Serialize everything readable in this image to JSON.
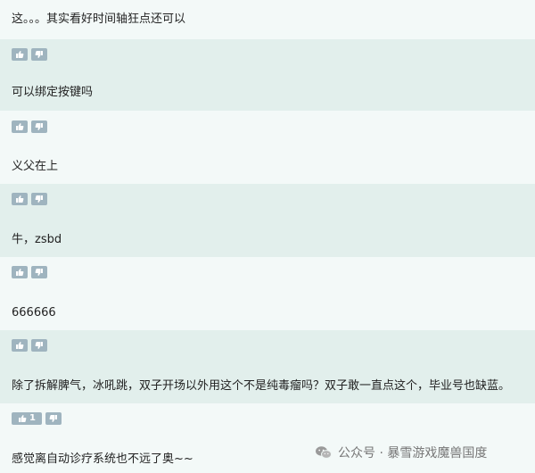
{
  "comments": [
    {
      "text": "这。。。其实看好时间轴狂点还可以",
      "upvotes": ""
    },
    {
      "text": "可以绑定按键吗",
      "upvotes": ""
    },
    {
      "text": "义父在上",
      "upvotes": ""
    },
    {
      "text": "牛，zsbd",
      "upvotes": ""
    },
    {
      "text": "666666",
      "upvotes": ""
    },
    {
      "text": "除了拆解脾气，冰吼跳，双子开场以外用这个不是纯毒瘤吗？双子敢一直点这个，毕业号也缺蓝。",
      "upvotes": "1"
    },
    {
      "text": "感觉离自动诊疗系统也不远了奥~~",
      "upvotes": ""
    }
  ],
  "icons": {
    "upvote": "thumbs-up-icon",
    "downvote": "thumbs-down-icon",
    "watermark": "wechat-icon"
  },
  "watermark": {
    "text": "公众号 · 暴雪游戏魔兽国度"
  },
  "colors": {
    "row_light": "#f3f9f8",
    "row_dark": "#e2efec",
    "vote_button": "#9fb4bf"
  }
}
